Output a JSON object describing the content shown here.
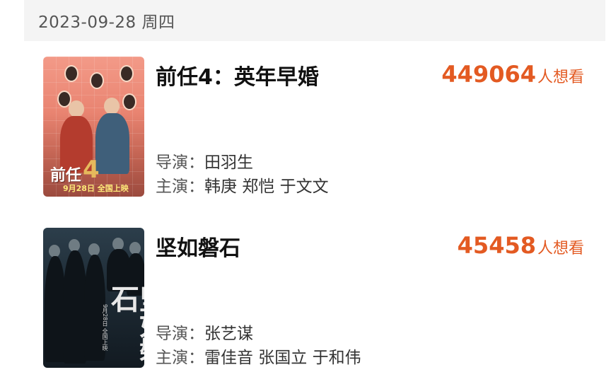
{
  "header": {
    "date": "2023-09-28 周四"
  },
  "movies": [
    {
      "title": "前任4：英年早婚",
      "want_count": "449064",
      "want_label": "人想看",
      "director_label": "导演：",
      "director": "田羽生",
      "cast_label": "主演：",
      "cast": "韩庚 郑恺 于文文",
      "poster_text": {
        "logo": "前任",
        "number": "4",
        "date": "9月28日 全国上映"
      }
    },
    {
      "title": "坚如磐石",
      "want_count": "45458",
      "want_label": "人想看",
      "director_label": "导演：",
      "director": "张艺谋",
      "cast_label": "主演：",
      "cast": "雷佳音 张国立 于和伟",
      "poster_text": {
        "calligraphy": "坚如磐石",
        "date": "9月28日 全国上映"
      }
    }
  ],
  "colors": {
    "accent": "#e35a22",
    "date_bar_bg": "#f4f4f4"
  }
}
